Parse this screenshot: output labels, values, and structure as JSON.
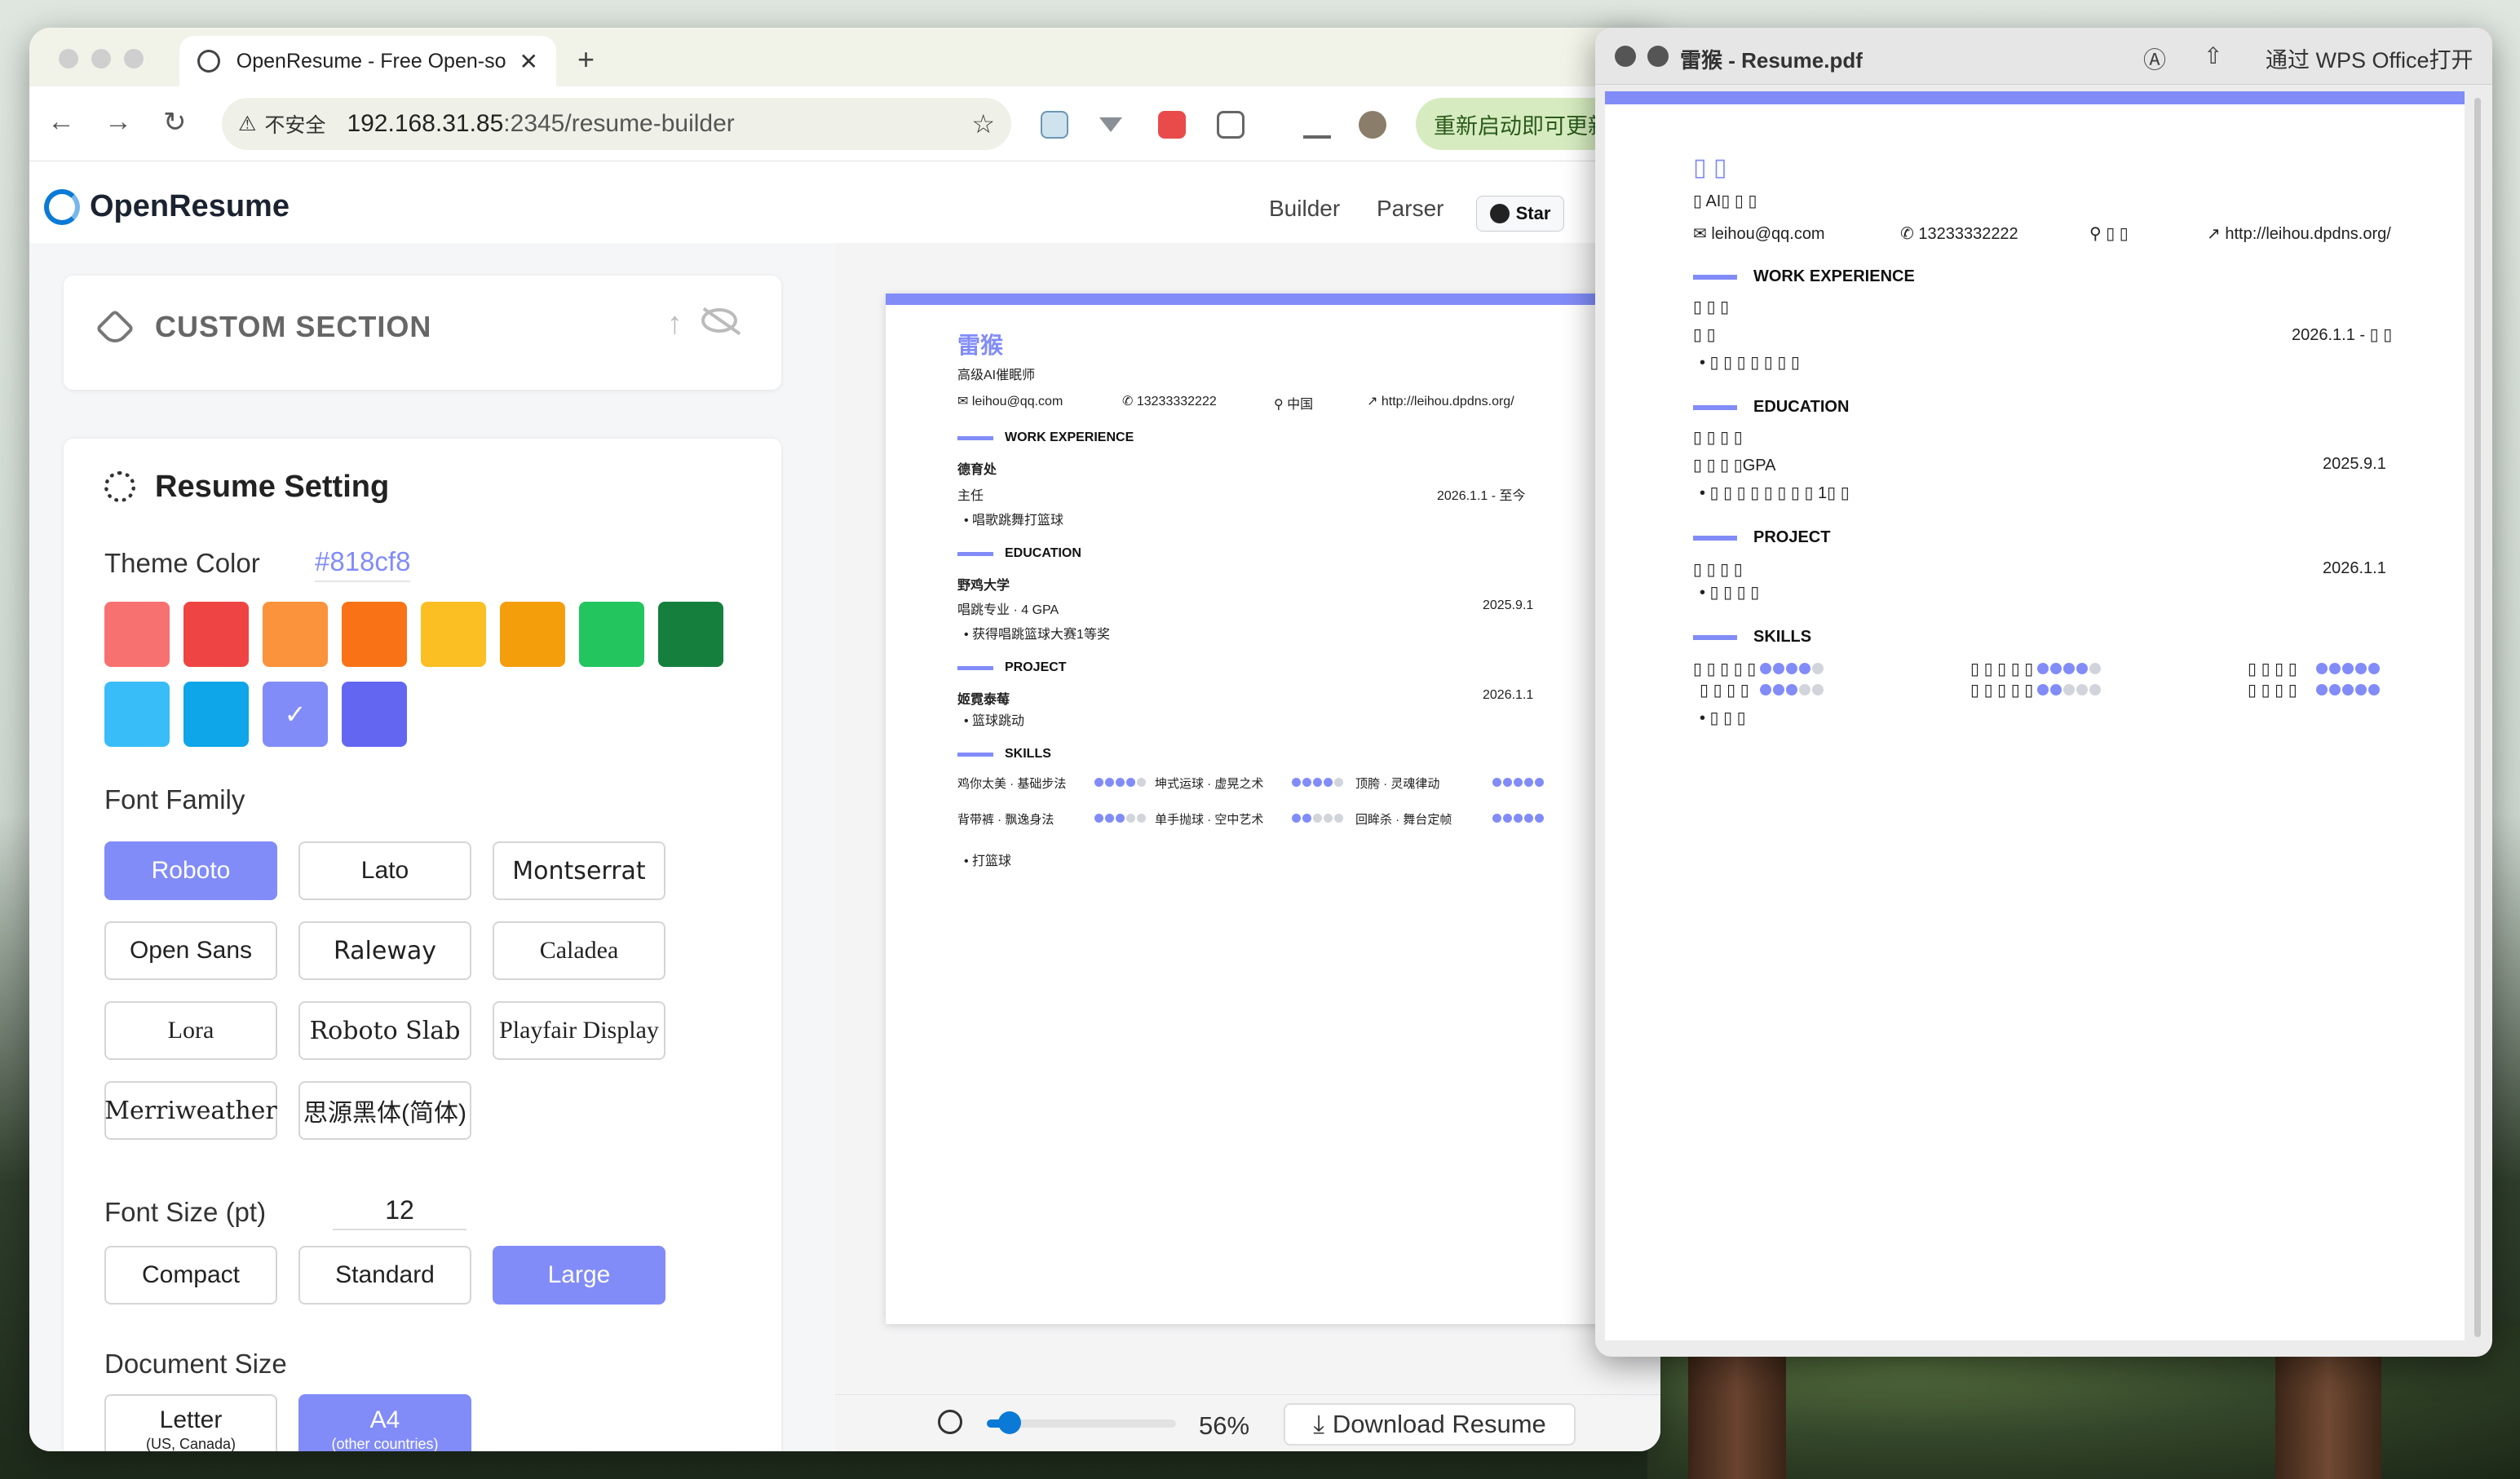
{
  "browser": {
    "tab_title": "OpenResume - Free Open-so",
    "security": "不安全",
    "url_host": "192.168.31.85",
    "url_rest": ":2345/resume-builder",
    "update_label": "重新启动即可更新"
  },
  "app": {
    "logo_text": "OpenResume",
    "nav": [
      "Builder",
      "Parser"
    ],
    "star_label": "Star"
  },
  "custom_section": {
    "title": "CUSTOM SECTION"
  },
  "settings": {
    "title": "Resume Setting",
    "theme_color_label": "Theme Color",
    "theme_color_value": "#818cf8",
    "colors": [
      "#f87171",
      "#ef4444",
      "#fb923c",
      "#f97316",
      "#fbbf24",
      "#f59e0b",
      "#22c55e",
      "#15803d",
      "#38bdf8",
      "#0ea5e9",
      "#818cf8",
      "#6366f1"
    ],
    "selected_color_check": "✓",
    "font_family_label": "Font Family",
    "fonts": [
      "Roboto",
      "Lato",
      "Montserrat",
      "Open Sans",
      "Raleway",
      "Caladea",
      "Lora",
      "Roboto Slab",
      "Playfair Display",
      "Merriweather",
      "思源黑体(简体)"
    ],
    "selected_font": "Roboto",
    "font_size_label": "Font Size (pt)",
    "font_size_value": "12",
    "size_options": [
      "Compact",
      "Standard",
      "Large"
    ],
    "selected_size": "Large",
    "doc_size_label": "Document Size",
    "doc_sizes": [
      "Letter",
      "A4"
    ],
    "doc_size_subs": [
      "(US, Canada)",
      "(other countries)"
    ],
    "selected_doc_size": "A4"
  },
  "resume": {
    "name": "雷猴",
    "title": "高级AI催眠师",
    "email": "leihou@qq.com",
    "phone": "13233332222",
    "location": "中国",
    "website": "http://leihou.dpdns.org/",
    "work_heading": "WORK EXPERIENCE",
    "work_company": "德育处",
    "work_role": "主任",
    "work_date": "2026.1.1 - 至今",
    "work_bullet": "• 唱歌跳舞打篮球",
    "edu_heading": "EDUCATION",
    "edu_school": "野鸡大学",
    "edu_degree": "唱跳专业 · 4 GPA",
    "edu_date": "2025.9.1",
    "edu_bullet": "• 获得唱跳篮球大赛1等奖",
    "proj_heading": "PROJECT",
    "proj_name": "姬霓泰莓",
    "proj_date": "2026.1.1",
    "proj_bullet": "• 篮球跳动",
    "skills_heading": "SKILLS",
    "skills": [
      {
        "name": "鸡你太美 · 基础步法",
        "level": 4
      },
      {
        "name": "坤式运球 · 虚晃之术",
        "level": 4
      },
      {
        "name": "顶胯 · 灵魂律动",
        "level": 5
      },
      {
        "name": "背带裤 · 飘逸身法",
        "level": 3
      },
      {
        "name": "单手抛球 · 空中艺术",
        "level": 2
      },
      {
        "name": "回眸杀 · 舞台定帧",
        "level": 5
      }
    ],
    "extra_bullet": "• 打篮球"
  },
  "zoom": {
    "percent": "56%",
    "value_fraction": 0.06,
    "download_label": "Download Resume"
  },
  "pdf": {
    "title": "雷猴 - Resume.pdf",
    "open_with": "通过 WPS Office打开",
    "name": "󠁿󠁿▯ ▯",
    "title_line": "▯ AI▯ ▯ ▯",
    "email": "leihou@qq.com",
    "phone": "13233332222",
    "location": "▯ ▯",
    "website": "http://leihou.dpdns.org/",
    "work_heading": "WORK EXPERIENCE",
    "work_company": "▯ ▯ ▯",
    "work_role": "▯ ▯",
    "work_date": "2026.1.1 - ▯ ▯",
    "work_bullet": "• ▯ ▯ ▯ ▯ ▯ ▯ ▯",
    "edu_heading": "EDUCATION",
    "edu_school": "▯ ▯ ▯ ▯",
    "edu_degree": "▯ ▯ ▯ ▯GPA",
    "edu_date": "2025.9.1",
    "edu_bullet": "• ▯ ▯ ▯ ▯ ▯ ▯ ▯ ▯ 1▯ ▯",
    "proj_heading": "PROJECT",
    "proj_name": "▯ ▯ ▯ ▯",
    "proj_date": "2026.1.1",
    "proj_bullet": "• ▯ ▯ ▯ ▯",
    "skills_heading": "SKILLS",
    "skill_row1": "▯ ▯ ▯ ▯ ▯",
    "skill_row2": "▯ ▯ ▯ ▯",
    "skill_row3": "▯ ▯ ▯ ▯ ▯",
    "skill_row4": "▯ ▯ ▯ ▯ ▯",
    "skill_row5": "▯ ▯ ▯ ▯",
    "skill_row6": "▯ ▯ ▯ ▯",
    "extra_bullet": "• ▯ ▯ ▯"
  }
}
